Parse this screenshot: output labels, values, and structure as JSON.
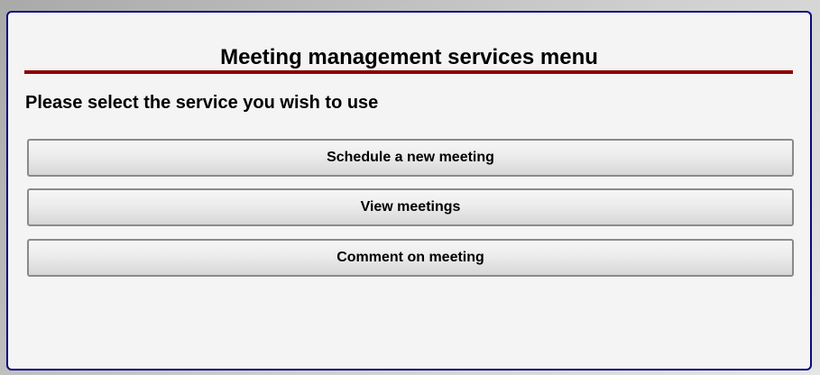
{
  "page": {
    "title": "Meeting management services menu",
    "prompt": "Please select the service you wish to use"
  },
  "menu": {
    "items": [
      {
        "label": "Schedule a new meeting"
      },
      {
        "label": "View meetings"
      },
      {
        "label": "Comment on meeting"
      }
    ]
  },
  "colors": {
    "panel_border": "#0a0a7a",
    "title_rule": "#8b0000",
    "panel_background": "#f4f4f4"
  }
}
